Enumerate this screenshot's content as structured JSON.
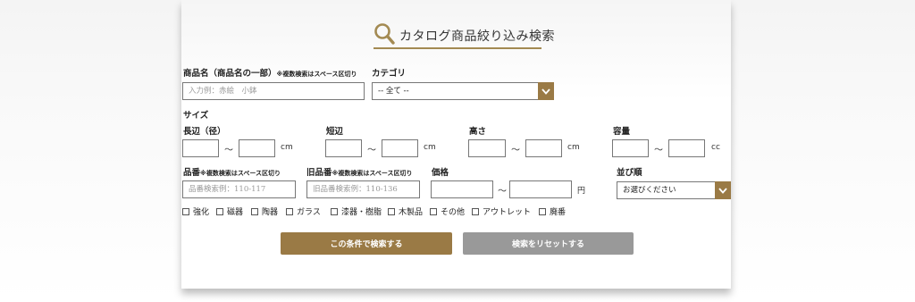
{
  "header": {
    "title": "カタログ商品絞り込み検索"
  },
  "labels": {
    "product_name": "商品名（商品名の一部）",
    "product_name_note": "※複数検索はスペース区切り",
    "category": "カテゴリ",
    "size": "サイズ",
    "long_side": "長辺（径）",
    "short_side": "短辺",
    "height": "高さ",
    "capacity": "容量",
    "product_no": "品番",
    "product_no_note": "※複数検索はスペース区切り",
    "old_product_no": "旧品番",
    "old_product_no_note": "※複数検索はスペース区切り",
    "price": "価格",
    "sort": "並び順"
  },
  "inputs": {
    "product_name_placeholder": "入力例：赤絵　小鉢",
    "product_no_placeholder": "品番検索例：110-117",
    "old_product_no_placeholder": "旧品番検索例：110-136"
  },
  "selects": {
    "category_value": "-- 全て --",
    "sort_value": "お選びください"
  },
  "units": {
    "tilde": "～",
    "cm": "cm",
    "cc": "cc",
    "yen": "円"
  },
  "checkboxes": [
    "強化",
    "磁器",
    "陶器",
    "ガラス",
    "漆器・樹脂",
    "木製品",
    "その他",
    "アウトレット",
    "廃番"
  ],
  "buttons": {
    "search": "この条件で検索する",
    "reset": "検索をリセットする"
  },
  "colors": {
    "accent": "#9a7a45",
    "reset_gray": "#999999"
  }
}
